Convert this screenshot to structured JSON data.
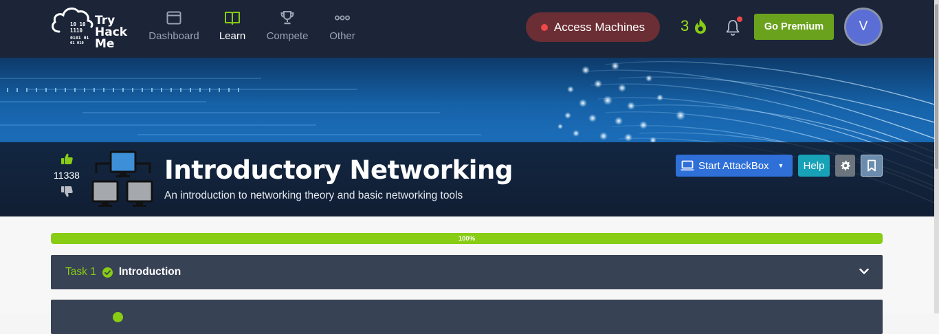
{
  "navbar": {
    "logo": {
      "word_lines": [
        "Try",
        "Hack",
        "Me"
      ],
      "binary_lines": [
        "10  10",
        "1110",
        "0101  01",
        "01  010"
      ]
    },
    "items": [
      {
        "label": "Dashboard",
        "icon": "browser-window-icon"
      },
      {
        "label": "Learn",
        "icon": "book-open-icon",
        "active": true
      },
      {
        "label": "Compete",
        "icon": "trophy-icon"
      },
      {
        "label": "Other",
        "icon": "more-dots-icon"
      }
    ],
    "access_machines": "Access Machines",
    "streak": "3",
    "go_premium": "Go Premium",
    "avatar_letter": "V"
  },
  "room": {
    "votes": "11338",
    "title": "Introductory Networking",
    "subtitle": "An introduction to networking theory and basic networking tools",
    "start_attackbox": "Start AttackBox",
    "help": "Help"
  },
  "progress": {
    "label": "100%",
    "value": 1.0
  },
  "tasks": [
    {
      "number": "Task 1",
      "title": "Introduction",
      "completed": true
    },
    {
      "number": "",
      "title": "",
      "completed": true
    }
  ],
  "colors": {
    "navbar_bg": "#1c2538",
    "accent_green": "#88cc14",
    "premium_green": "#6aa21d",
    "access_red": "#6a2e34",
    "attackbox_blue": "#2f6fd8",
    "help_teal": "#17a2b8",
    "task_bg": "#384255"
  }
}
